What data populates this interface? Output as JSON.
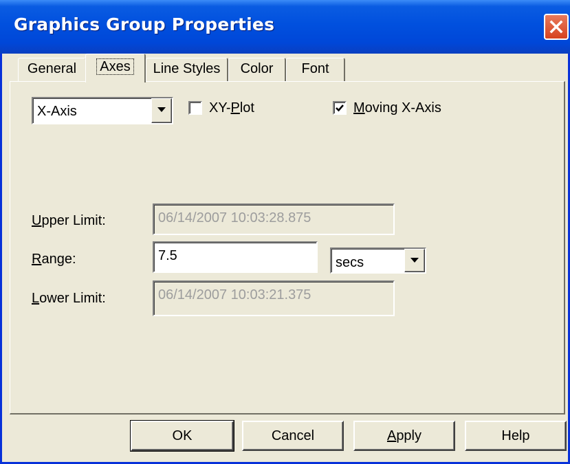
{
  "window": {
    "title": "Graphics Group Properties",
    "close_icon": "close-icon"
  },
  "tabs": [
    {
      "label": "General"
    },
    {
      "label": "Axes",
      "active": true
    },
    {
      "label": "Line Styles"
    },
    {
      "label": "Color"
    },
    {
      "label": "Font"
    }
  ],
  "axes": {
    "axis_select": {
      "value": "X-Axis"
    },
    "xy_plot": {
      "label_pre": "XY-",
      "label_key": "P",
      "label_post": "lot",
      "checked": false
    },
    "moving_x_axis": {
      "label_key": "M",
      "label_post": "oving X-Axis",
      "checked": true
    },
    "upper_limit": {
      "label_key": "U",
      "label_post": "pper Limit:",
      "value": "06/14/2007 10:03:28.875"
    },
    "range": {
      "label_key": "R",
      "label_post": "ange:",
      "value": "7.5",
      "unit": "secs"
    },
    "lower_limit": {
      "label_key": "L",
      "label_post": "ower Limit:",
      "value": "06/14/2007 10:03:21.375"
    }
  },
  "buttons": {
    "ok": "OK",
    "cancel": "Cancel",
    "apply_key": "A",
    "apply_post": "pply",
    "help": "Help"
  },
  "colors": {
    "titlebar": "#0150de",
    "face": "#ece9d8",
    "close": "#d6421e"
  }
}
